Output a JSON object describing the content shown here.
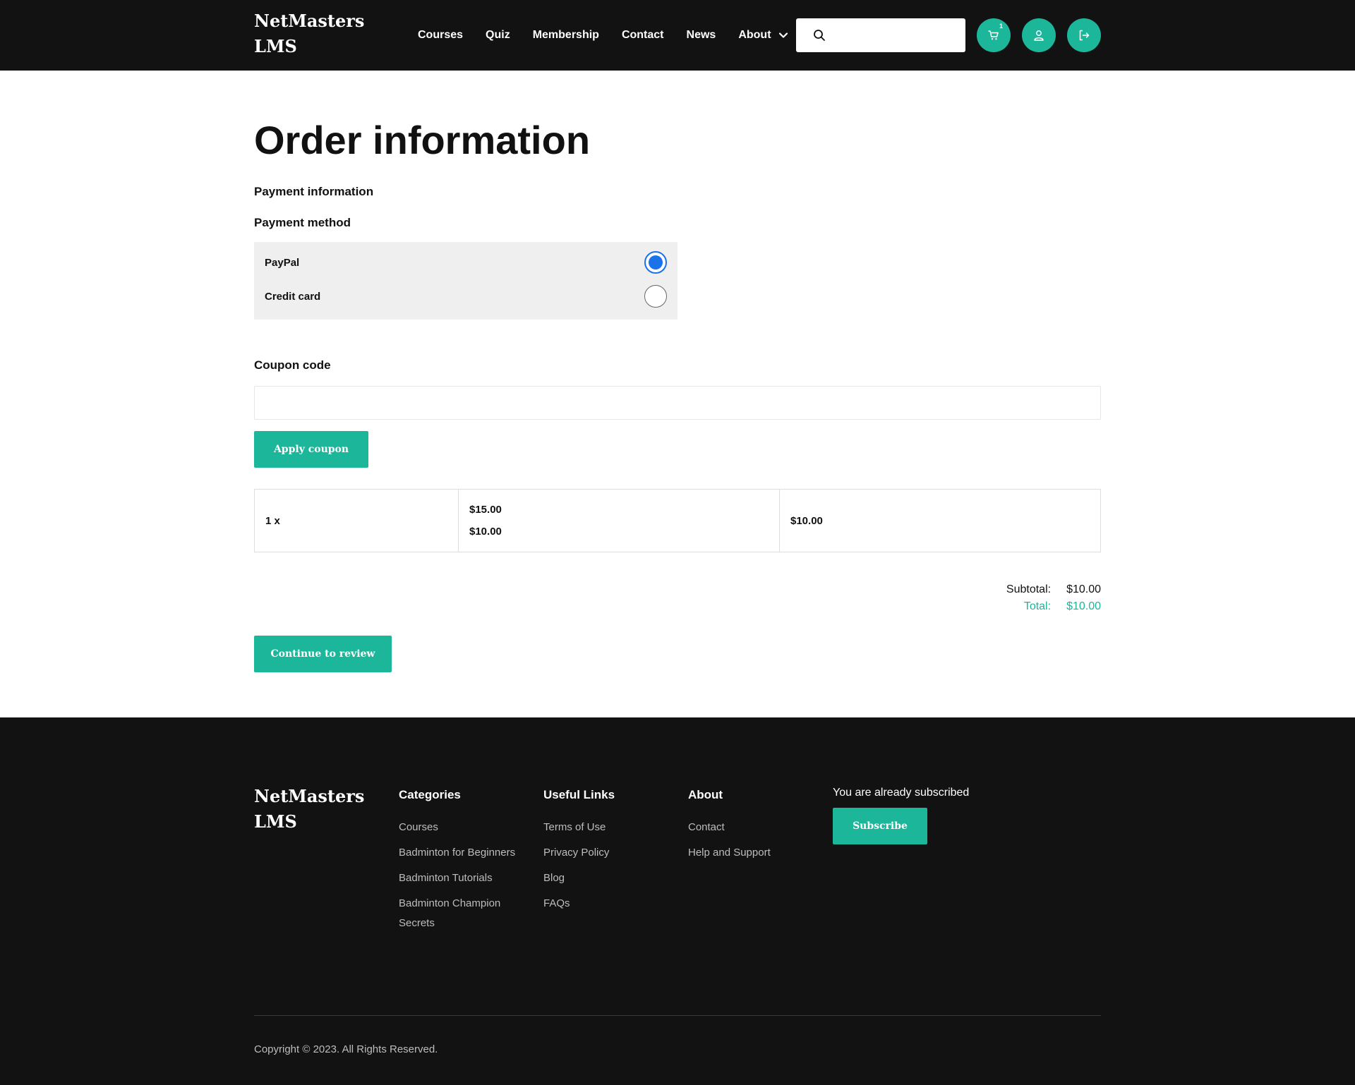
{
  "header": {
    "brand": "NetMasters LMS",
    "nav": [
      {
        "label": "Courses"
      },
      {
        "label": "Quiz"
      },
      {
        "label": "Membership"
      },
      {
        "label": "Contact"
      },
      {
        "label": "News"
      },
      {
        "label": "About",
        "has_dropdown": true
      }
    ],
    "search": {
      "placeholder": "",
      "value": ""
    },
    "cart_count": "1",
    "icons": [
      "search-icon",
      "cart-icon",
      "user-icon",
      "logout-icon",
      "chevron-down-icon"
    ]
  },
  "main": {
    "title": "Order information",
    "payment_info_label": "Payment information",
    "payment_method_label": "Payment method",
    "payment_options": [
      {
        "label": "PayPal",
        "selected": true
      },
      {
        "label": "Credit card",
        "selected": false
      }
    ],
    "coupon_label": "Coupon code",
    "coupon_value": "",
    "apply_coupon_label": "Apply coupon",
    "order_row": {
      "quantity": "1 x",
      "original_price": "$15.00",
      "sale_price": "$10.00",
      "line_total": "$10.00"
    },
    "subtotal_label": "Subtotal:",
    "subtotal_value": "$10.00",
    "total_label": "Total:",
    "total_value": "$10.00",
    "continue_label": "Continue to review"
  },
  "footer": {
    "brand": "NetMasters LMS",
    "categories": {
      "heading": "Categories",
      "links": [
        "Courses",
        "Badminton for Beginners",
        "Badminton Tutorials",
        "Badminton Champion Secrets"
      ]
    },
    "useful_links": {
      "heading": "Useful Links",
      "links": [
        "Terms of Use",
        "Privacy Policy",
        "Blog",
        "FAQs"
      ]
    },
    "about": {
      "heading": "About",
      "links": [
        "Contact",
        "Help and Support"
      ]
    },
    "subscribed_text": "You are already subscribed",
    "subscribe_label": "Subscribe",
    "copyright": "Copyright © 2023. All Rights Reserved."
  },
  "colors": {
    "accent": "#1cb69b",
    "dark": "#121212",
    "radio_selected": "#1a73e8"
  }
}
